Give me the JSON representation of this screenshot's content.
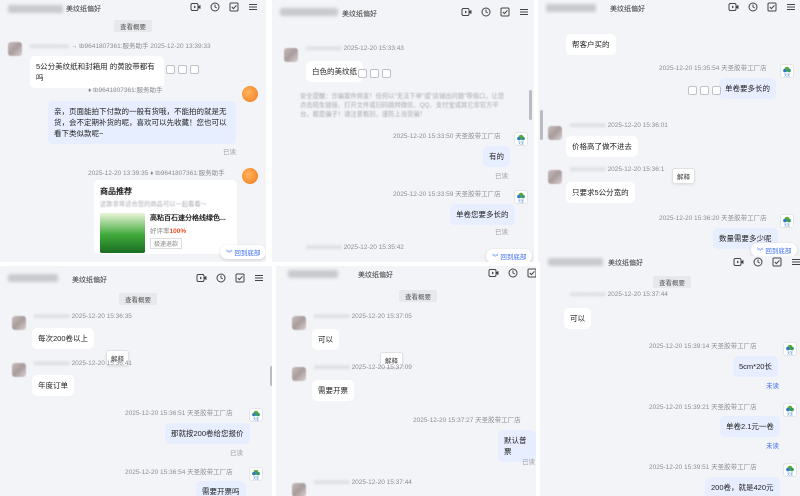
{
  "shop_name": "天圣胶带工厂店",
  "colors": {
    "accent": "#3a6cf0",
    "self_bubble": "#e7eeff",
    "panel_bg": "#f3f4f7"
  },
  "panels": {
    "p1": {
      "title": "美纹纸偏好",
      "pill": "查看概要",
      "m1_meta": "tb9641807361:服务助手    2025-12-20 13:39:33",
      "m1_text": "5公分美纹纸和封箱用 的黄胶带都有吗",
      "m2_meta": "tb9641807361:服务助手",
      "m2_time": "2025-12-20 13:39:35",
      "m2_text": "亲，页面能拍下付款的一般有货哦，不能拍的就是无货，会不定期补货的呢，喜欢可以先收藏！您也可以看下类似款呢~",
      "m2_read": "已读",
      "m3_time": "2025-12-20 13:39:35",
      "m3_meta": "tb9641807361:服务助手",
      "card_title": "商品推荐",
      "card_sub": "这款非常适合您的商品可以一起看看～",
      "card_product": "高粘百石速分格线绿色...",
      "card_rate_label": "好评率",
      "card_rate": "100%",
      "card_tag": "极速退款",
      "jump": "回到底部"
    },
    "p2": {
      "title": "美纹纸偏好",
      "m1_time": "2025-12-20 15:33:43",
      "m1_text": "白色的美纹纸",
      "sys_note": "安全提醒：诈骗案件频发！任何以\"无法下单\"或\"店铺出问题\"等借口，让您点击陌生链接、打开文件或扫码跳转微信、QQ、支付宝或其它非官方平台，都是骗子！请注意甄别，谨防上当受骗！",
      "m2_time": "2025-12-20 15:33:50",
      "m2_text": "有的",
      "m2_read": "已读",
      "m3_time": "2025-12-20 15:33:59",
      "m3_text": "单卷您要多长的",
      "m3_read": "已读",
      "m4_time": "2025-12-20 15:35:42",
      "jump": "回到底部"
    },
    "p3": {
      "title": "美纹纸偏好",
      "m0_text": "帮客户买的",
      "m1_time": "2025-12-20 15:35:54",
      "m1_text": "单卷要多长的",
      "m2_time": "2025-12-20 15:36:01",
      "m2_text": "价格高了做不进去",
      "m3_time": "2025-12-20 15:36:1",
      "m3_tip": "解释",
      "m3_text": "只要求5公分宽的",
      "m4_time": "2025-12-20 15:36:20",
      "m4_text": "数量需要多少呢",
      "jump": "回到底部"
    },
    "p4": {
      "title": "美纹纸偏好",
      "pill": "查看概要",
      "m1_time": "2025-12-20 15:36:35",
      "m1_text": "每次200卷以上",
      "m2_tip": "解释",
      "m2_time": "2025-12-20 15:36:41",
      "m2_text": "年度订单",
      "m3_time": "2025-12-20 15:36:51",
      "m3_text": "那就按200卷给您报价",
      "m3_read": "已读",
      "m4_time": "2025-12-20 15:36:54",
      "m4_text": "需要开票吗"
    },
    "p5": {
      "title": "美纹纸偏好",
      "pill": "查看概要",
      "m1_time": "2025-12-20 15:37:05",
      "m1_text": "可以",
      "m2_tip": "解释",
      "m2_time": "2025-12-20 15:37:09",
      "m2_text": "需要开票",
      "m3_time": "2025-12-20 15:37:27",
      "m3_text": "默认普票",
      "m3_read": "已读",
      "m4_time": "2025-12-20 15:37:44"
    },
    "p6": {
      "title": "美纹纸偏好",
      "pill": "查看概要",
      "m1_time": "2025-12-20 15:37:44",
      "m1_text": "可以",
      "m2_time": "2025-12-20 15:39:14",
      "m2_text": "5cm*20长",
      "m2_status": "未读",
      "m3_time": "2025-12-20 15:39:21",
      "m3_text": "单卷2.1元一卷",
      "m3_status": "未读",
      "m4_time": "2025-12-20 15:39:51",
      "m4_text": "200卷，就是420元"
    }
  }
}
